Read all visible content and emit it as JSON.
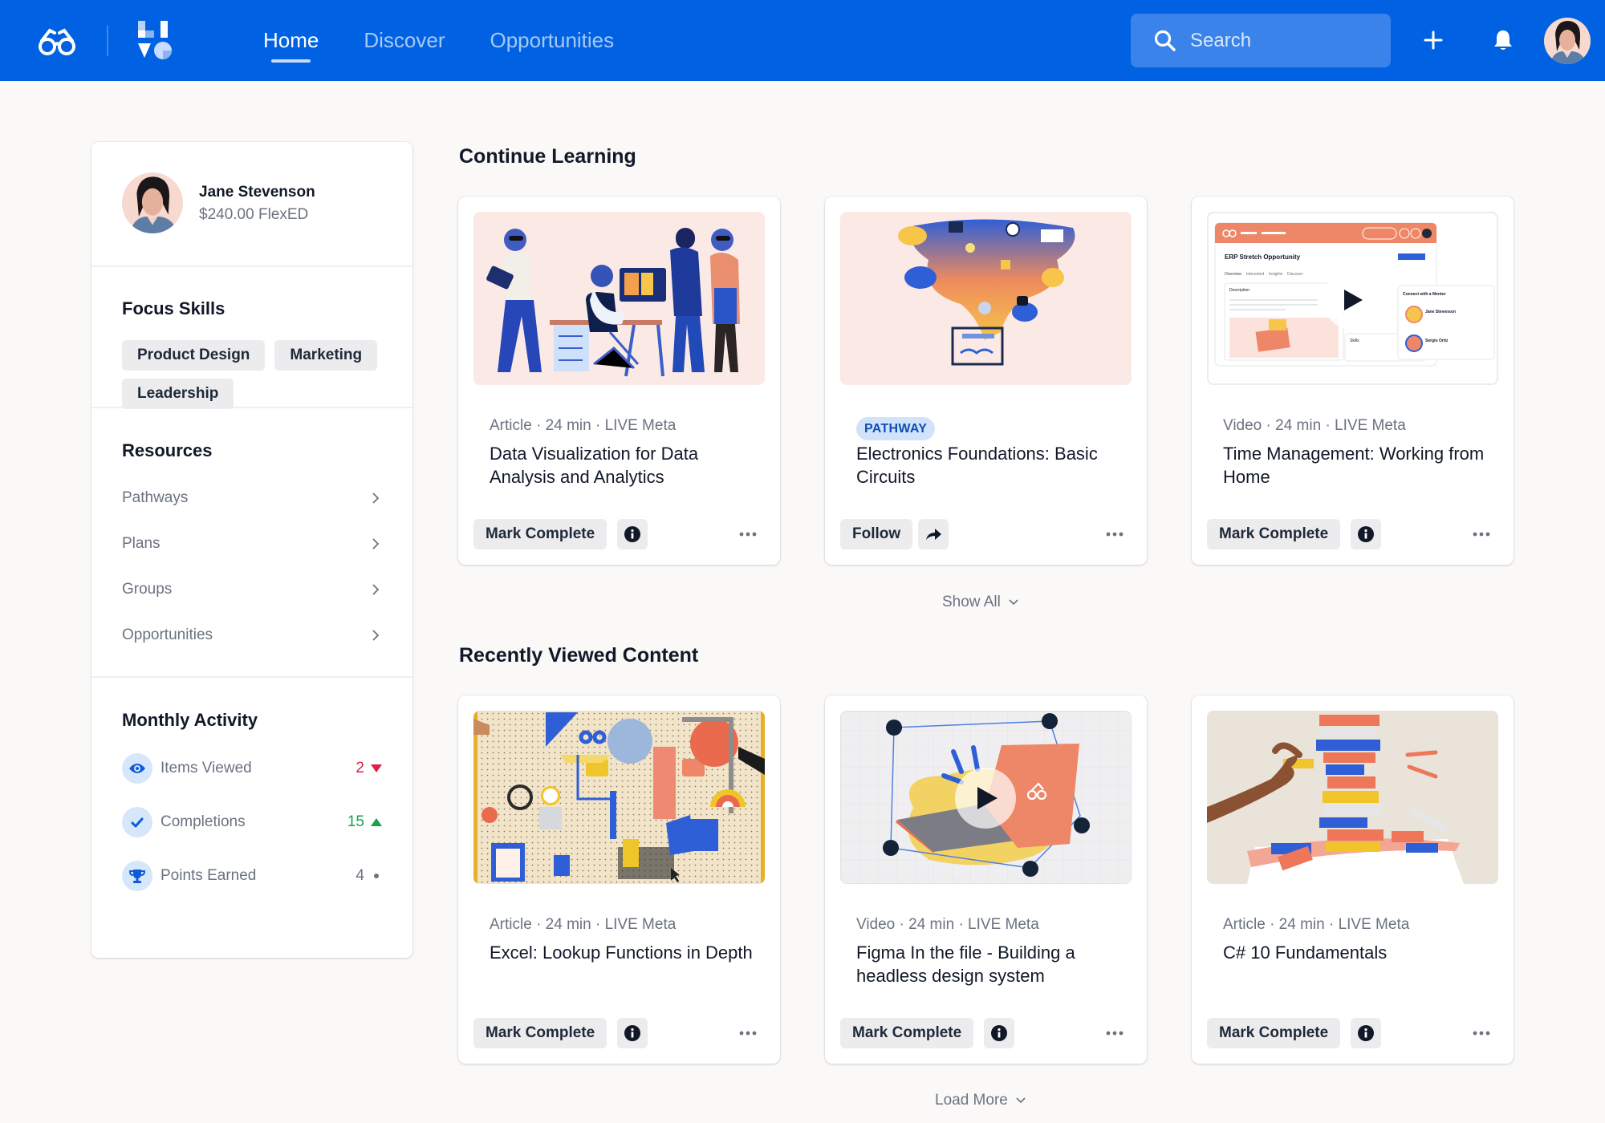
{
  "header": {
    "nav": [
      "Home",
      "Discover",
      "Opportunities"
    ],
    "active_nav": "Home",
    "search_placeholder": "Search",
    "brand_color": "#0062e3"
  },
  "sidebar": {
    "profile": {
      "name": "Jane Stevenson",
      "balance": "$240.00 FlexED"
    },
    "focus_skills": {
      "title": "Focus Skills",
      "skills": [
        "Product Design",
        "Marketing",
        "Leadership"
      ]
    },
    "resources": {
      "title": "Resources",
      "items": [
        "Pathways",
        "Plans",
        "Groups",
        "Opportunities"
      ]
    },
    "monthly_activity": {
      "title": "Monthly Activity",
      "items": [
        {
          "label": "Items Viewed",
          "value": "2",
          "trend": "down",
          "color": "#e11d48",
          "icon": "eye-icon"
        },
        {
          "label": "Completions",
          "value": "15",
          "trend": "up",
          "color": "#16a34a",
          "icon": "check-icon"
        },
        {
          "label": "Points Earned",
          "value": "4",
          "trend": "neutral",
          "color": "#6b7280",
          "icon": "trophy-icon"
        }
      ]
    }
  },
  "continue_learning": {
    "title": "Continue Learning",
    "show_all": "Show All",
    "cards": [
      {
        "meta": "Article · 24 min · LIVE Meta",
        "title": "Data Visualization for Data Analysis and Analytics",
        "action": "Mark Complete",
        "secondary_icon": "info-icon"
      },
      {
        "badge": "PATHWAY",
        "title": "Electronics Foundations: Basic Circuits",
        "action": "Follow",
        "secondary_icon": "share-icon"
      },
      {
        "meta": "Video · 24 min · LIVE Meta",
        "title": "Time Management: Working from Home",
        "action": "Mark Complete",
        "secondary_icon": "info-icon",
        "thumb_text": {
          "title": "ERP Stretch Opportunity",
          "tabs": [
            "Overview",
            "Interested",
            "Insights",
            "Discover"
          ],
          "description": "Description",
          "panel_title": "Connect with a Mentor",
          "mentors": [
            "Jane Stevenson",
            "Sergio Ortiz"
          ],
          "skills_label": "Skills"
        }
      }
    ]
  },
  "recently_viewed": {
    "title": "Recently Viewed Content",
    "load_more": "Load More",
    "cards": [
      {
        "meta": "Article · 24 min · LIVE Meta",
        "title": "Excel: Lookup Functions in Depth",
        "action": "Mark Complete",
        "secondary_icon": "info-icon"
      },
      {
        "meta": "Video · 24 min · LIVE Meta",
        "title": "Figma In the file - Building a headless design system",
        "action": "Mark Complete",
        "secondary_icon": "info-icon"
      },
      {
        "meta": "Article · 24 min · LIVE Meta",
        "title": "C# 10 Fundamentals",
        "action": "Mark Complete",
        "secondary_icon": "info-icon"
      }
    ]
  }
}
